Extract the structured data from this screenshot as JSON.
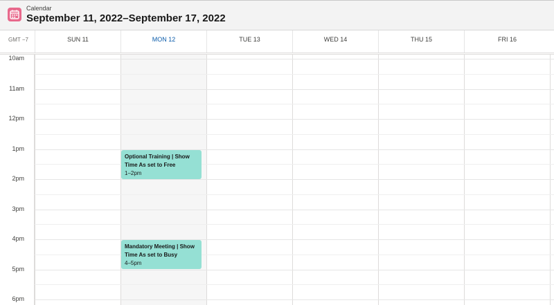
{
  "header": {
    "label": "Calendar",
    "title": "September 11, 2022–September 17, 2022"
  },
  "day_row": {
    "timezone": "GMT −7",
    "days": [
      {
        "label": "SUN 11",
        "today": false
      },
      {
        "label": "MON 12",
        "today": true
      },
      {
        "label": "TUE 13",
        "today": false
      },
      {
        "label": "WED 14",
        "today": false
      },
      {
        "label": "THU 15",
        "today": false
      },
      {
        "label": "FRI 16",
        "today": false
      }
    ]
  },
  "times": [
    "10am",
    "11am",
    "12pm",
    "1pm",
    "2pm",
    "3pm",
    "4pm",
    "5pm",
    "6pm"
  ],
  "events": [
    {
      "title": "Optional Training | Show Time As set to Free",
      "time": "1–2pm"
    },
    {
      "title": "Mandatory Meeting | Show Time As set to Busy",
      "time": "4–5pm"
    }
  ],
  "colors": {
    "accent": "#0b5cab",
    "event": "#95e0d4",
    "icon": "#e8698c"
  }
}
